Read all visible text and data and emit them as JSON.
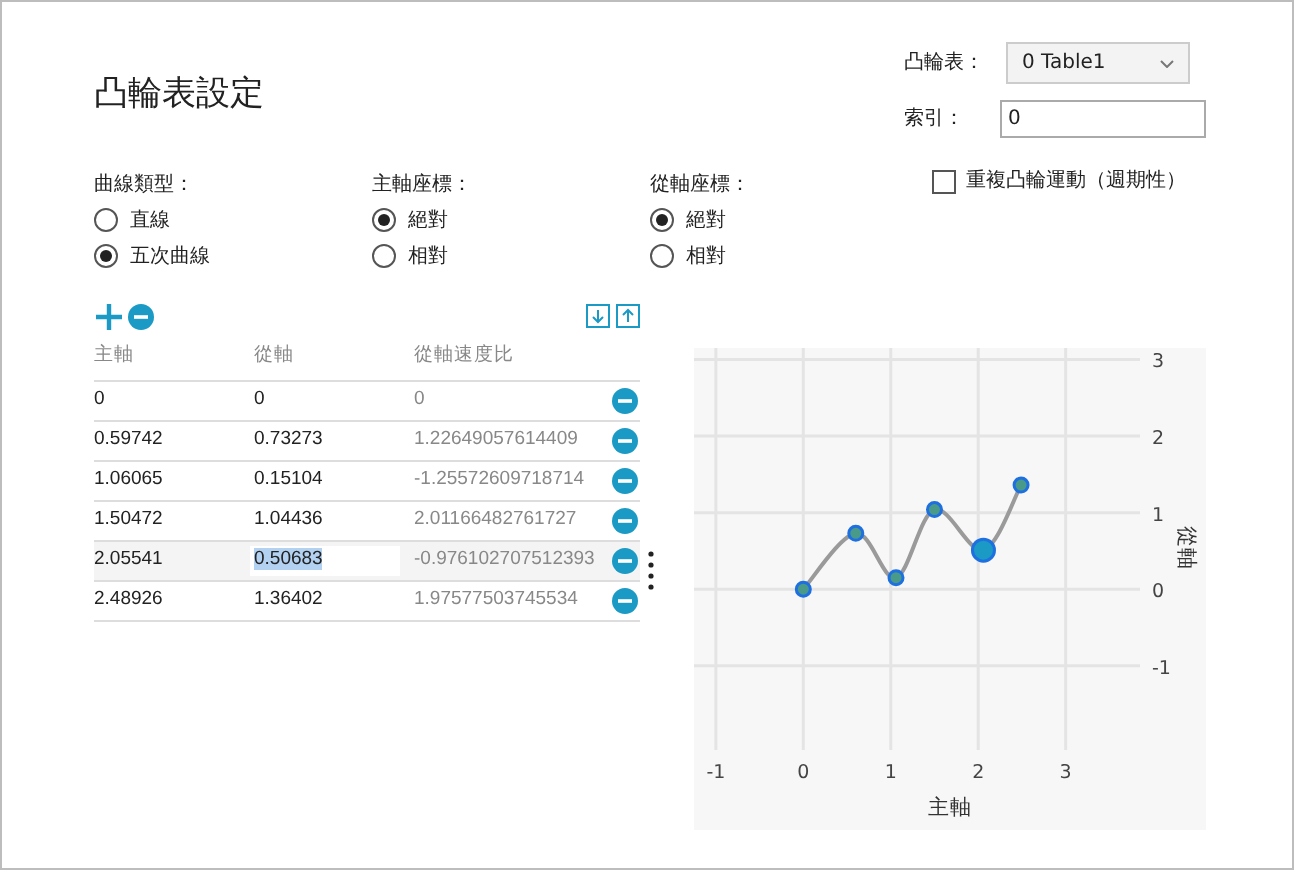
{
  "title": "凸輪表設定",
  "cam_table": {
    "label": "凸輪表：",
    "value": "0 Table1"
  },
  "index": {
    "label": "索引：",
    "value": "0"
  },
  "repeat": {
    "label": "重複凸輪運動（週期性）",
    "checked": false
  },
  "radio_groups": [
    {
      "label": "曲線類型：",
      "options": [
        {
          "label": "直線",
          "selected": false
        },
        {
          "label": "五次曲線",
          "selected": true
        }
      ]
    },
    {
      "label": "主軸座標：",
      "options": [
        {
          "label": "絕對",
          "selected": true
        },
        {
          "label": "相對",
          "selected": false
        }
      ]
    },
    {
      "label": "從軸座標：",
      "options": [
        {
          "label": "絕對",
          "selected": true
        },
        {
          "label": "相對",
          "selected": false
        }
      ]
    }
  ],
  "table": {
    "columns": [
      "主軸",
      "從軸",
      "從軸速度比"
    ],
    "rows": [
      {
        "cells": [
          "0",
          "0",
          "0"
        ],
        "selected": false
      },
      {
        "cells": [
          "0.59742",
          "0.73273",
          "1.22649057614409"
        ],
        "selected": false
      },
      {
        "cells": [
          "1.06065",
          "0.15104",
          "-1.25572609718714"
        ],
        "selected": false
      },
      {
        "cells": [
          "1.50472",
          "1.04436",
          "2.01166482761727"
        ],
        "selected": false
      },
      {
        "cells": [
          "2.05541",
          "0.50683",
          "-0.976102707512393"
        ],
        "selected": true
      },
      {
        "cells": [
          "2.48926",
          "1.36402",
          "1.97577503745534"
        ],
        "selected": false
      }
    ]
  },
  "chart": {
    "chart_data": {
      "type": "line",
      "xlabel": "主軸",
      "ylabel": "從軸",
      "x": [
        0,
        0.6,
        1.06,
        1.5,
        2.06,
        2.49
      ],
      "series": [
        {
          "color": "#1e6fe0",
          "marker": true,
          "values": [
            0,
            0.73,
            0.15,
            1.04,
            0.51,
            1.36
          ]
        }
      ],
      "grid": true,
      "xlim": [
        -1.25,
        3.85
      ],
      "ylim": [
        -2.1,
        3.15
      ],
      "xticks": [
        -1,
        0,
        1,
        2,
        3
      ],
      "yticks": [
        -1,
        0,
        1,
        2,
        3
      ]
    }
  }
}
